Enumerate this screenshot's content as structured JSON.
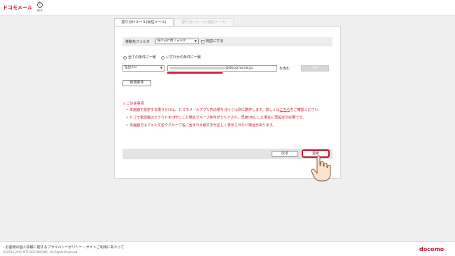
{
  "header": {
    "logo_text": "ドコモメール",
    "back_label": "戻る",
    "back_icon": "back-arrow-icon"
  },
  "tabs": [
    {
      "label": "振り分けルール(受信メール)",
      "active": true
    },
    {
      "label": "振り分けルール(送信メール)",
      "active": false
    }
  ],
  "folder_row": {
    "label": "移動先フォルダ",
    "select_value": "振り分け用フォルダ",
    "checkbox_label": "既読にする",
    "checked": false
  },
  "condition_mode": {
    "options": [
      "全ての条件に一致",
      "いずれかの条件に一致"
    ],
    "selected": 0
  },
  "condition_row": {
    "field_select": "差出人に",
    "value_domain": "@docomo.ne.jp",
    "operator": "を含む",
    "delete_label": "削除"
  },
  "new_condition_label": "新規条件",
  "notice": {
    "title": "ご注意事項",
    "items": [
      {
        "text": "本画面で設定する振り分けは、ドコモメールアプリ内の振り分けとは別に動作します。詳しくは",
        "link": "こちら",
        "suffix": "をご確認ください。"
      },
      {
        "text": "ドコモ電話帳のクラウドをOFFにした場合グループ条件がクリアされ、再度ONにした場合に再設定が必要です。"
      },
      {
        "text": "本画面ではフォルダ名やグループ名に含まれる絵文字が正しく表示されない場合があります。"
      }
    ]
  },
  "actions": {
    "back_label": "戻る",
    "update_label": "更新"
  },
  "footer": {
    "links": [
      "お客様の個人情報に関するプライバシーポリシー",
      "サイトご利用にあたって"
    ],
    "copyright": "(C)2013-2015 NTT DOCOMO,INC. All Rights Reserved.",
    "brand": "docomo"
  },
  "colors": {
    "brand_red": "#c8102e"
  }
}
